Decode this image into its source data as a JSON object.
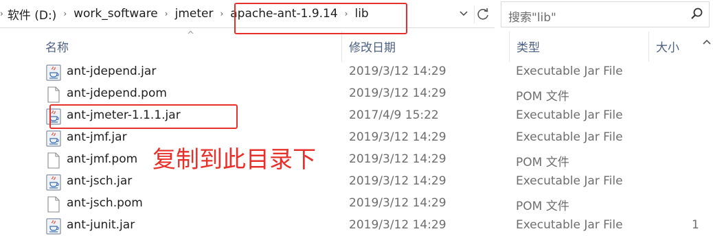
{
  "breadcrumb": {
    "items": [
      "软件 (D:)",
      "work_software",
      "jmeter",
      "apache-ant-1.9.14",
      "lib"
    ]
  },
  "search": {
    "placeholder": "搜索\"lib\""
  },
  "columns": {
    "name": "名称",
    "date": "修改日期",
    "type": "类型",
    "size": "大小"
  },
  "files": [
    {
      "name": "ant-jdepend.jar",
      "date": "2019/3/12 14:29",
      "type": "Executable Jar File",
      "size": "",
      "icon": "jar-file-icon"
    },
    {
      "name": "ant-jdepend.pom",
      "date": "2019/3/12 14:29",
      "type": "POM 文件",
      "size": "",
      "icon": "document-file-icon"
    },
    {
      "name": "ant-jmeter-1.1.1.jar",
      "date": "2017/4/9 15:22",
      "type": "Executable Jar File",
      "size": "",
      "icon": "jar-file-icon"
    },
    {
      "name": "ant-jmf.jar",
      "date": "2019/3/12 14:29",
      "type": "Executable Jar File",
      "size": "",
      "icon": "jar-file-icon"
    },
    {
      "name": "ant-jmf.pom",
      "date": "2019/3/12 14:29",
      "type": "POM 文件",
      "size": "",
      "icon": "document-file-icon"
    },
    {
      "name": "ant-jsch.jar",
      "date": "2019/3/12 14:29",
      "type": "Executable Jar File",
      "size": "",
      "icon": "jar-file-icon"
    },
    {
      "name": "ant-jsch.pom",
      "date": "2019/3/12 14:29",
      "type": "POM 文件",
      "size": "",
      "icon": "document-file-icon"
    },
    {
      "name": "ant-junit.jar",
      "date": "2019/3/12 14:29",
      "type": "Executable Jar File",
      "size": "1",
      "icon": "jar-file-icon"
    }
  ],
  "annotation": {
    "text": "复制到此目录下"
  },
  "colors": {
    "highlight": "#e8302b",
    "header_text": "#4d6082",
    "secondary_text": "#6d6d6d"
  }
}
